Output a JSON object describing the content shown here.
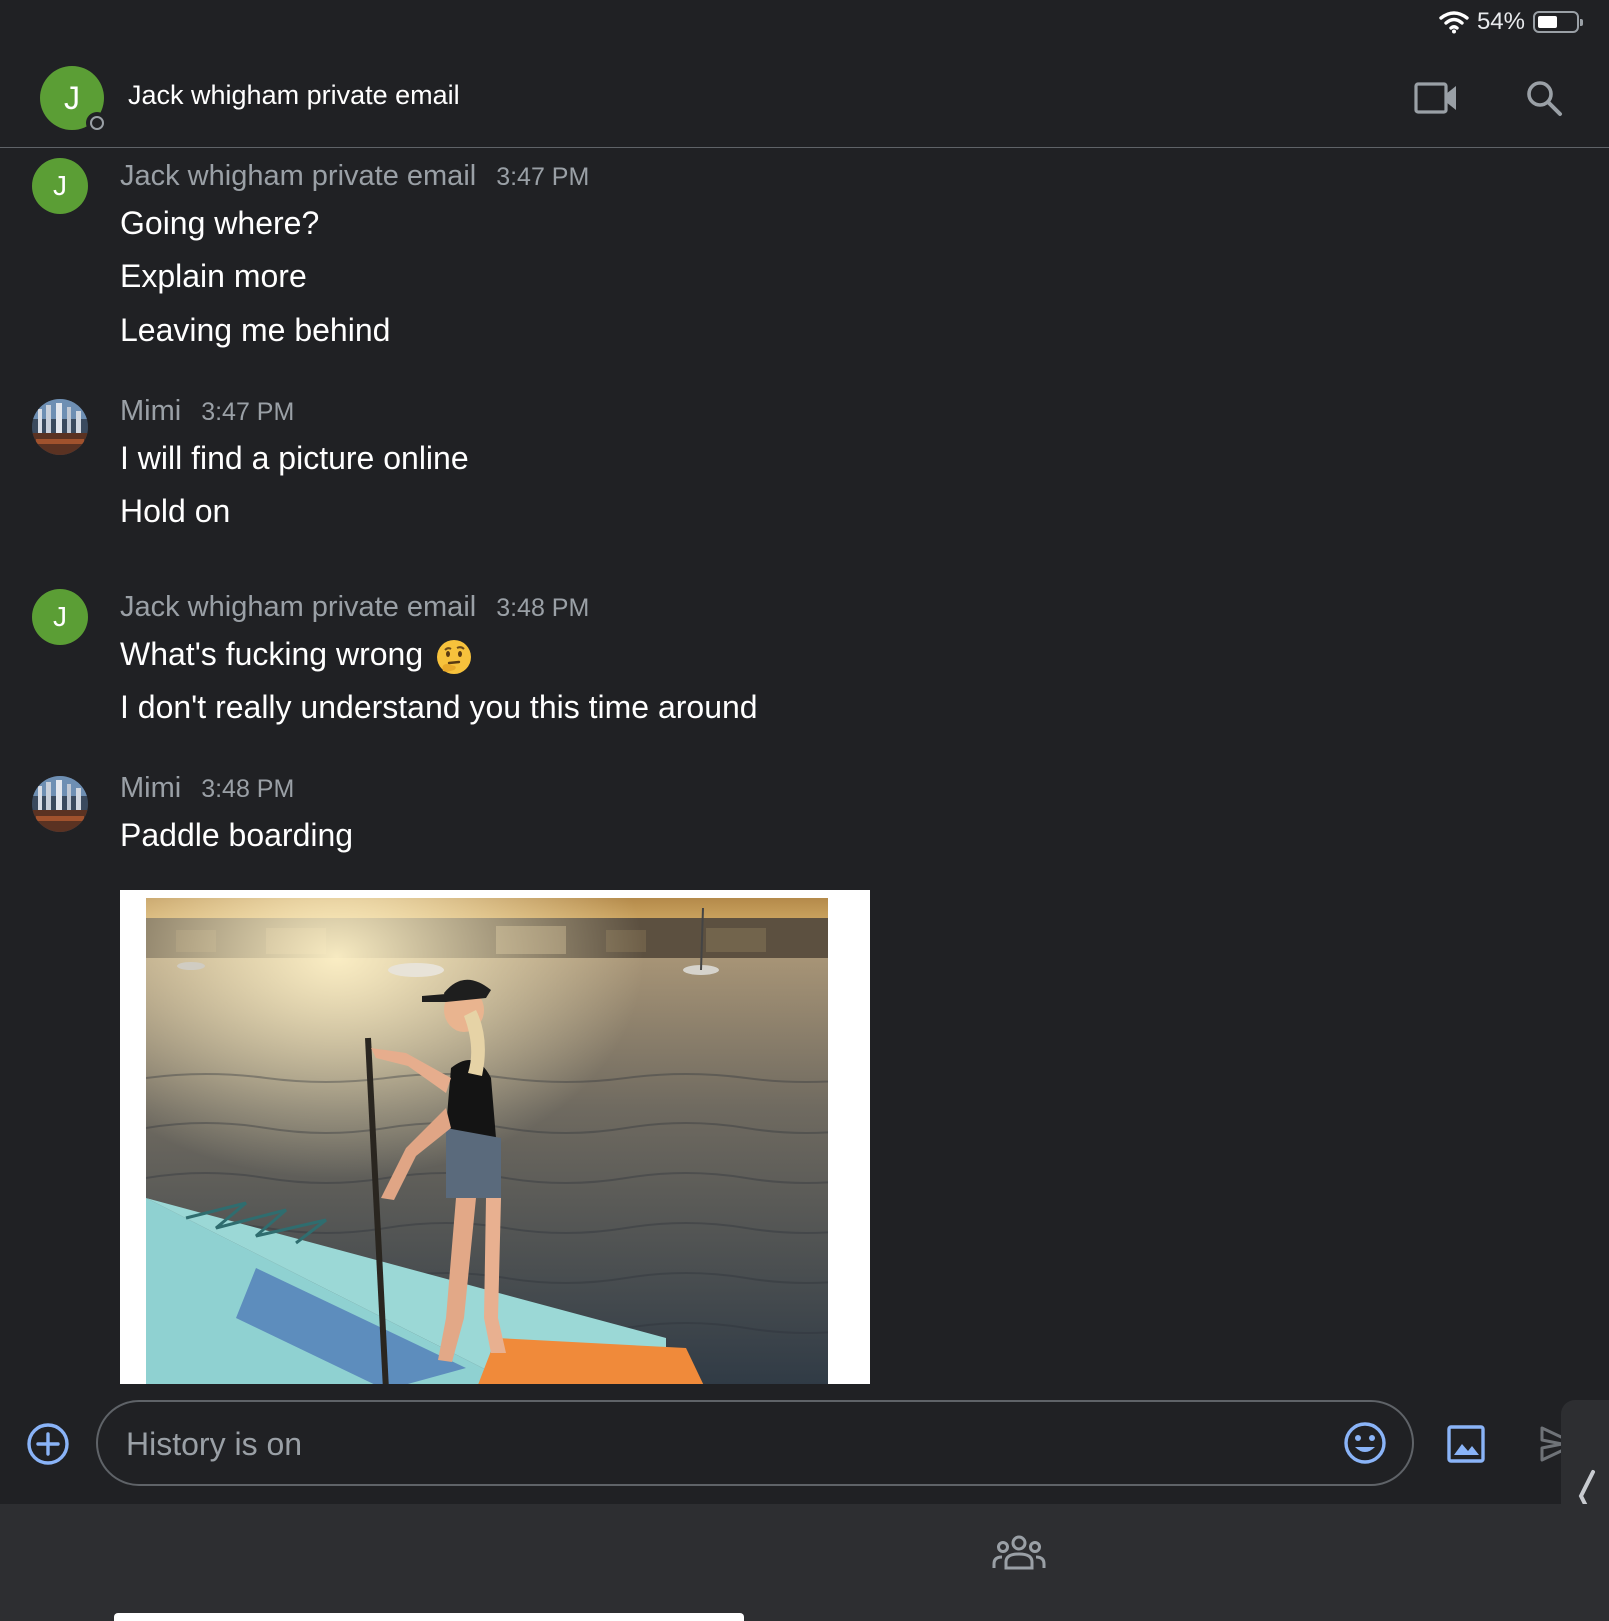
{
  "status_bar": {
    "battery_percent": "54%",
    "battery_level": 0.54,
    "icons": [
      "wifi-icon",
      "battery-icon"
    ]
  },
  "header": {
    "avatar_initial": "J",
    "title": "Jack whigham private email",
    "actions": [
      "video-call-icon",
      "search-icon"
    ]
  },
  "messages": [
    {
      "sender": "Jack whigham private email",
      "time": "3:47 PM",
      "avatar": "J",
      "lines": [
        "Going where?",
        "Explain more",
        "Leaving me behind"
      ]
    },
    {
      "sender": "Mimi",
      "time": "3:47 PM",
      "avatar": "photo",
      "lines": [
        "I will find a picture online",
        "Hold on"
      ]
    },
    {
      "sender": "Jack whigham private email",
      "time": "3:48 PM",
      "avatar": "J",
      "lines": [
        "What's fucking wrong",
        "I don't really understand you this time around"
      ],
      "emoji": "thinking-face-emoji"
    },
    {
      "sender": "Mimi",
      "time": "3:48 PM",
      "avatar": "photo",
      "lines": [
        "Paddle boarding"
      ],
      "attachment": "image"
    }
  ],
  "composer": {
    "placeholder": "History is on",
    "icons": [
      "add-icon",
      "emoji-icon",
      "image-icon",
      "send-icon"
    ]
  },
  "bottom_bar": {
    "icons": [
      "members-icon"
    ]
  },
  "colors": {
    "background": "#202124",
    "avatar_green": "#5b9e35",
    "accent_blue": "#8ab4f8",
    "muted_text": "#9aa0a6"
  }
}
